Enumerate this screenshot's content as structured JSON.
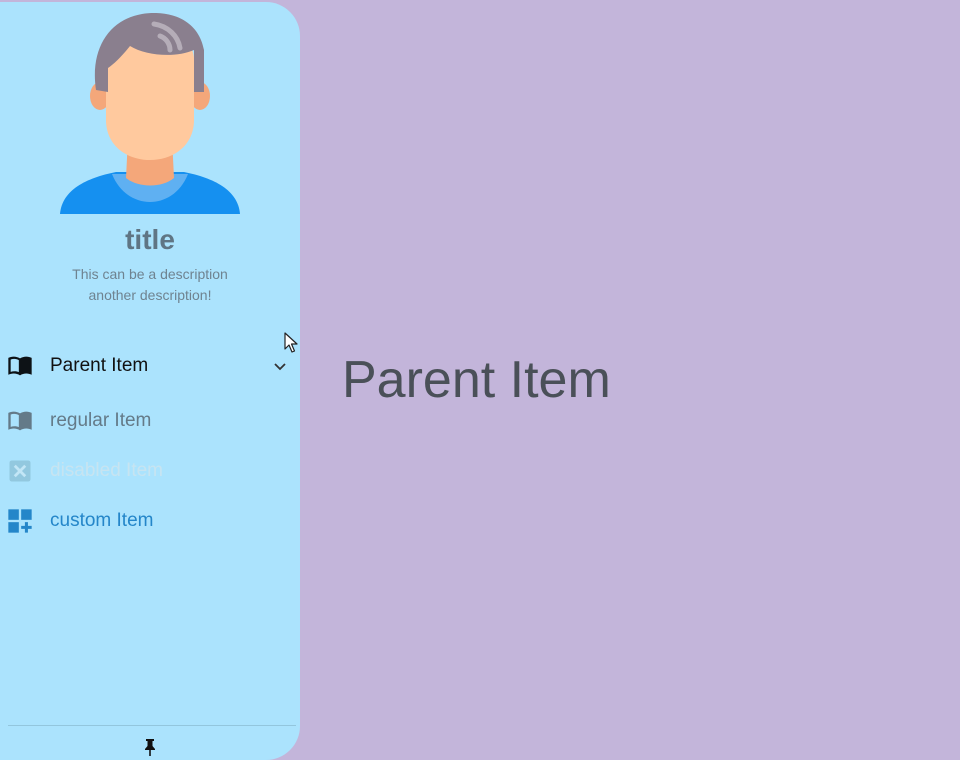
{
  "main": {
    "title": "Parent Item"
  },
  "drawer": {
    "title": "title",
    "description_lines": [
      "This can be a description",
      "another description!"
    ],
    "items": [
      {
        "label": "Parent Item",
        "icon": "book-icon",
        "expandable": true
      },
      {
        "label": "regular Item",
        "icon": "book-icon"
      },
      {
        "label": "disabled Item",
        "icon": "disabled-box-icon",
        "disabled": true
      },
      {
        "label": "custom Item",
        "icon": "dashboard-add-icon"
      }
    ],
    "footer_icon": "pin-icon"
  },
  "colors": {
    "drawer_bg": "#abe3fd",
    "main_bg": "#c3b5da",
    "custom_accent": "#2486c9",
    "title_text": "#5f7584"
  }
}
